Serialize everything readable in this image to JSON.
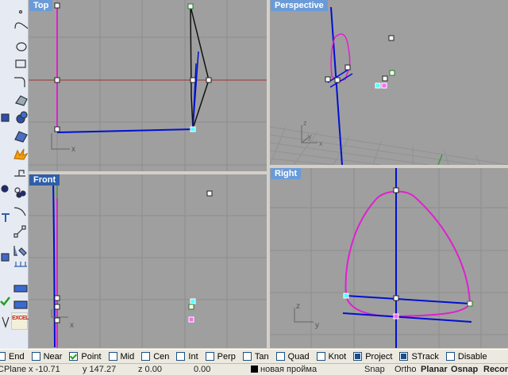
{
  "toolbar": {
    "icons": [
      "point-icon",
      "curve-icon",
      "circle-icon",
      "ellipse-icon",
      "arc-icon",
      "rectangle-icon",
      "fillet-icon",
      "surface-icon",
      "box-icon",
      "sphere-icon",
      "extrude-icon",
      "mesh-icon",
      "explode-icon",
      "boolean-icon",
      "split-icon",
      "trim-icon",
      "points-on-icon",
      "dimension-icon",
      "text-icon",
      "transform-icon",
      "array-icon",
      "print-icon",
      "scan-icon",
      "check-icon",
      "excel-icon"
    ],
    "excel_label": "EXCEL"
  },
  "viewports": {
    "top": "Top",
    "perspective": "Perspective",
    "front": "Front",
    "right": "Right"
  },
  "axes": {
    "x": "x",
    "y": "y",
    "z": "z"
  },
  "osnap": [
    {
      "label": "End",
      "state": "off"
    },
    {
      "label": "Near",
      "state": "off"
    },
    {
      "label": "Point",
      "state": "checked"
    },
    {
      "label": "Mid",
      "state": "off"
    },
    {
      "label": "Cen",
      "state": "off"
    },
    {
      "label": "Int",
      "state": "off"
    },
    {
      "label": "Perp",
      "state": "off"
    },
    {
      "label": "Tan",
      "state": "off"
    },
    {
      "label": "Quad",
      "state": "off"
    },
    {
      "label": "Knot",
      "state": "off"
    },
    {
      "label": "Project",
      "state": "filled"
    },
    {
      "label": "STrack",
      "state": "filled"
    },
    {
      "label": "Disable",
      "state": "off"
    }
  ],
  "status": {
    "cplane": "CPlane",
    "x": "x -10.71",
    "y": "y 147.27",
    "z": "z 0.00",
    "dist": "0.00",
    "layer": "новая пройма",
    "layer_color": "#000000",
    "snap": "Snap",
    "ortho": "Ortho",
    "planar": "Planar",
    "osnap": "Osnap",
    "record": "Record"
  },
  "colors": {
    "viewport_bg": "#9f9f9f",
    "curve_magenta": "#e020d0",
    "curve_blue": "#0010d0",
    "axis_red": "#a03030"
  }
}
